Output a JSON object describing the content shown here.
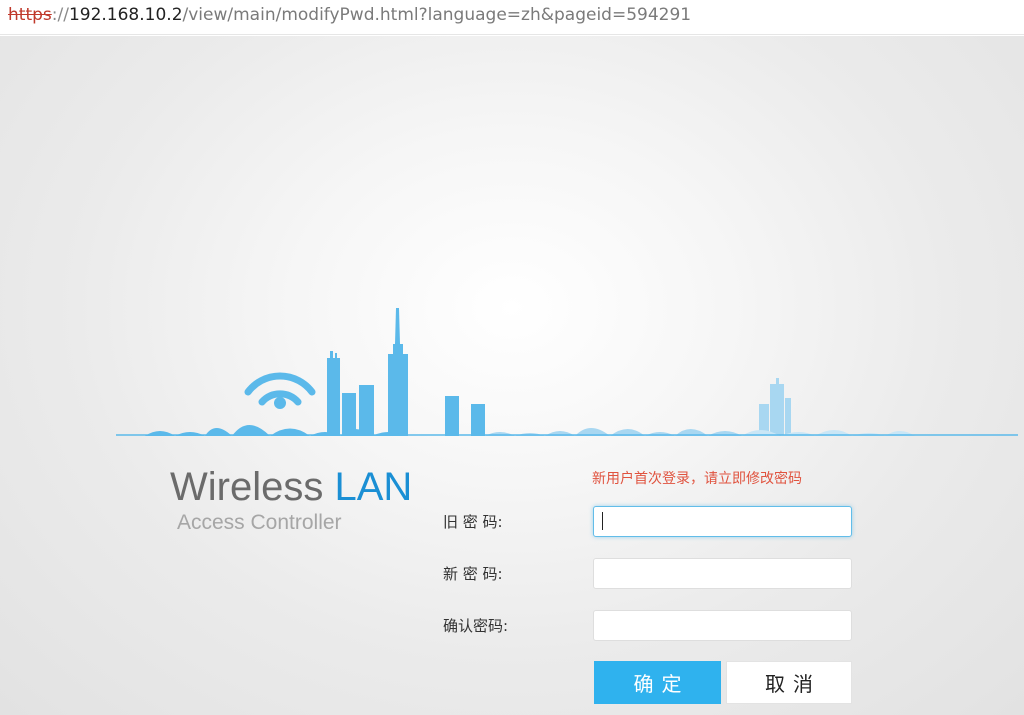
{
  "browser": {
    "url_scheme": "https",
    "url_separator": "://",
    "url_host": "192.168.10.2",
    "url_path": "/view/main/modifyPwd.html?language=zh&pageid=594291"
  },
  "brand": {
    "title_part1": "Wireless ",
    "title_part2": "LAN",
    "subtitle": "Access Controller"
  },
  "form": {
    "notice": "新用户首次登录，请立即修改密码",
    "old_password_label": "旧 密 码:",
    "new_password_label": "新 密 码:",
    "confirm_password_label": "确认密码:",
    "old_password_value": "",
    "new_password_value": "",
    "confirm_password_value": ""
  },
  "buttons": {
    "confirm": "确定",
    "cancel": "取消"
  },
  "colors": {
    "accent": "#2fb2ee",
    "brand_blue": "#1b8fd4",
    "skyline": "#5bb9ea",
    "warning": "#e0533f"
  }
}
